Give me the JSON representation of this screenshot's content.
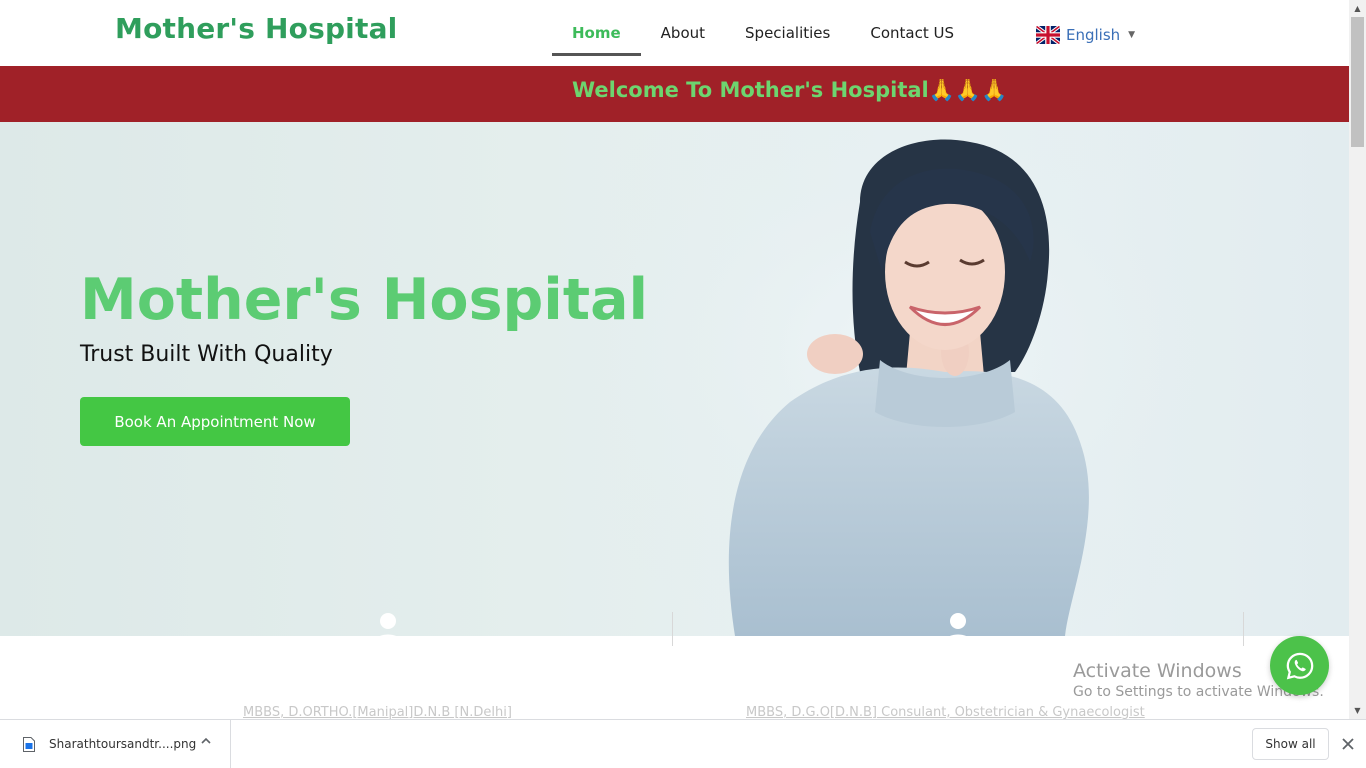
{
  "header": {
    "logo": "Mother's Hospital",
    "nav": [
      {
        "label": "Home",
        "active": true
      },
      {
        "label": "About",
        "active": false
      },
      {
        "label": "Specialities",
        "active": false
      },
      {
        "label": "Contact US",
        "active": false
      }
    ],
    "language": {
      "label": "English",
      "icon": "uk-flag-icon"
    }
  },
  "banner": {
    "text": "Welcome To Mother's Hospital🙏🙏🙏"
  },
  "hero": {
    "title": "Mother's Hospital",
    "subtitle": "Trust Built With Quality",
    "cta_label": "Book An Appointment Now"
  },
  "doctors": [
    {
      "qualification": "MBBS, D.ORTHO.[Manipal]D.N.B [N.Delhi]",
      "icon": "doctor-avatar-icon"
    },
    {
      "qualification": "MBBS, D.G.O[D.N.B] Consulant, Obstetrician & Gynaecologist",
      "icon": "doctor-avatar-icon"
    }
  ],
  "watermark": {
    "title": "Activate Windows",
    "subtitle": "Go to Settings to activate Windows."
  },
  "whatsapp": {
    "icon": "whatsapp-icon"
  },
  "download_bar": {
    "file_name": "Sharathtoursandtr....png",
    "show_all_label": "Show all"
  },
  "colors": {
    "brand_green": "#2f9e5c",
    "hero_green": "#5ccc73",
    "banner_red": "#a02128",
    "button_green": "#44c744"
  }
}
